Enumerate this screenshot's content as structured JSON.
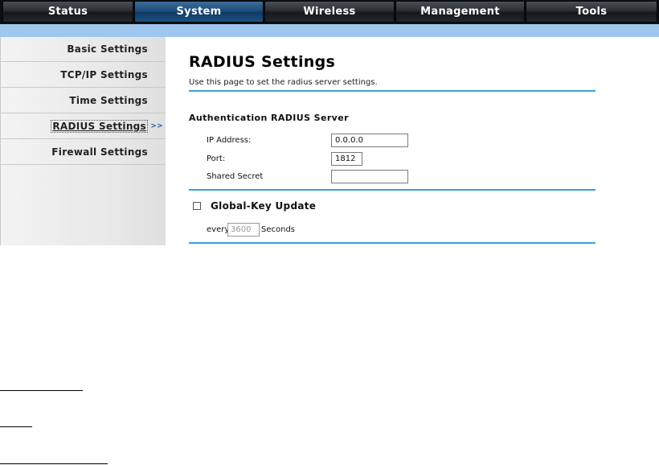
{
  "nav": {
    "tabs": [
      {
        "label": "Status"
      },
      {
        "label": "System"
      },
      {
        "label": "Wireless"
      },
      {
        "label": "Management"
      },
      {
        "label": "Tools"
      }
    ],
    "active_tab": "System"
  },
  "sidebar": {
    "items": [
      {
        "label": "Basic Settings"
      },
      {
        "label": "TCP/IP Settings"
      },
      {
        "label": "Time Settings"
      },
      {
        "label": "RADIUS Settings"
      },
      {
        "label": "Firewall Settings"
      }
    ],
    "current_item": "RADIUS Settings",
    "current_marker": ">>"
  },
  "page": {
    "title": "RADIUS Settings",
    "description": "Use this page to set the radius server settings."
  },
  "auth_server": {
    "heading": "Authentication RADIUS Server",
    "ip_label": "IP Address:",
    "ip_value": "0.0.0.0",
    "port_label": "Port:",
    "port_value": "1812",
    "secret_label": "Shared Secret",
    "secret_value": ""
  },
  "global_key": {
    "label": "Global-Key Update",
    "checked": false,
    "every_label": "every",
    "interval_value": "3600",
    "seconds_label": "Seconds"
  },
  "colors": {
    "nav_active": "#1f4d7a",
    "subbar": "#9fc6ec",
    "rule": "#3aa2d4"
  }
}
